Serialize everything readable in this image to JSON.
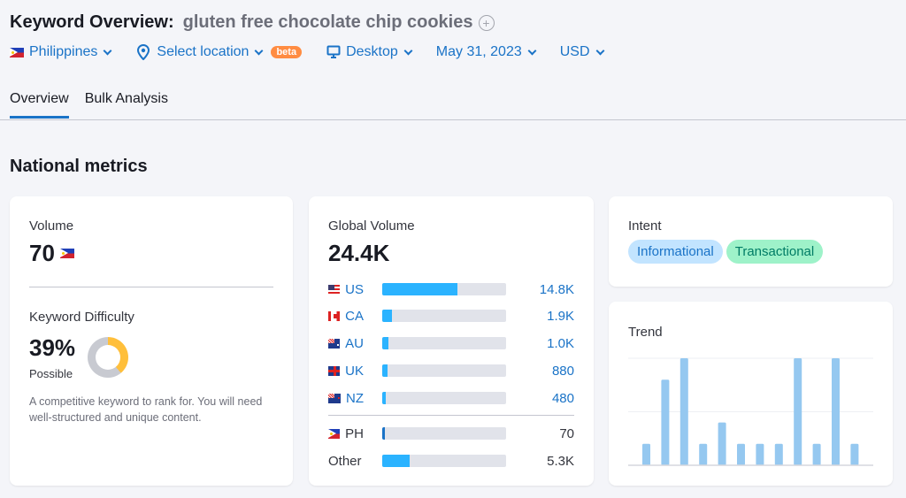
{
  "header": {
    "title": "Keyword Overview:",
    "keyword": "gluten free chocolate chip cookies",
    "add_icon": "plus-circle-icon"
  },
  "filters": {
    "country": "Philippines",
    "location": "Select location",
    "location_badge": "beta",
    "device": "Desktop",
    "date": "May 31, 2023",
    "currency": "USD"
  },
  "tabs": [
    {
      "label": "Overview",
      "active": true
    },
    {
      "label": "Bulk Analysis",
      "active": false
    }
  ],
  "section_title": "National metrics",
  "volume": {
    "label": "Volume",
    "value": "70",
    "flag": "PH"
  },
  "difficulty": {
    "label": "Keyword Difficulty",
    "value": "39%",
    "percent": 39,
    "rating": "Possible",
    "description": "A competitive keyword to rank for. You will need well-structured and unique content.",
    "colors": {
      "filled": "#ffbf3b",
      "empty": "#c8cad1"
    }
  },
  "global_volume": {
    "label": "Global Volume",
    "value": "24.4K",
    "countries": [
      {
        "code": "US",
        "value": "14.8K",
        "share": 0.61
      },
      {
        "code": "CA",
        "value": "1.9K",
        "share": 0.08
      },
      {
        "code": "AU",
        "value": "1.0K",
        "share": 0.05
      },
      {
        "code": "UK",
        "value": "880",
        "share": 0.04
      },
      {
        "code": "NZ",
        "value": "480",
        "share": 0.03
      }
    ],
    "local": {
      "code": "PH",
      "value": "70",
      "share": 0.02
    },
    "other": {
      "label": "Other",
      "value": "5.3K",
      "share": 0.22
    }
  },
  "intent": {
    "label": "Intent",
    "tags": [
      {
        "label": "Informational",
        "bg": "#c2e4ff",
        "fg": "#1a73c7"
      },
      {
        "label": "Transactional",
        "bg": "#9ef2c9",
        "fg": "#007c65"
      }
    ]
  },
  "trend": {
    "label": "Trend",
    "values": [
      0.2,
      0.8,
      1.0,
      0.2,
      0.4,
      0.2,
      0.2,
      0.2,
      1.0,
      0.2,
      1.0,
      0.2
    ],
    "bar_color": "#95c8f0"
  }
}
